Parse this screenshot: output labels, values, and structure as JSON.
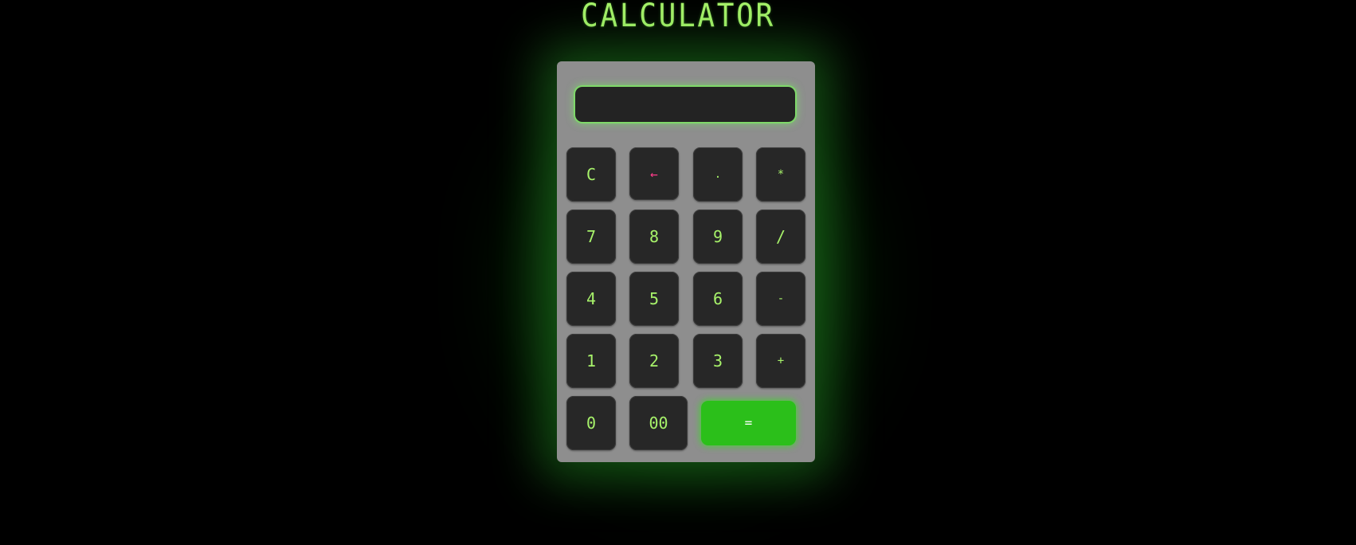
{
  "app": {
    "title": "CALCULATOR"
  },
  "display": {
    "value": ""
  },
  "keys": {
    "row1": [
      "C",
      "←",
      ".",
      "*"
    ],
    "row2": [
      "7",
      "8",
      "9",
      "/"
    ],
    "row3": [
      "4",
      "5",
      "6",
      "-"
    ],
    "row4": [
      "1",
      "2",
      "3",
      "+"
    ],
    "row5": [
      "0",
      "00",
      "="
    ]
  },
  "colors": {
    "background": "#000000",
    "digit": "#a7f26a",
    "backspace": "#ff3b8a",
    "equals": "#2bbf1a",
    "body": "#8e8e8e",
    "key": "#272727"
  }
}
